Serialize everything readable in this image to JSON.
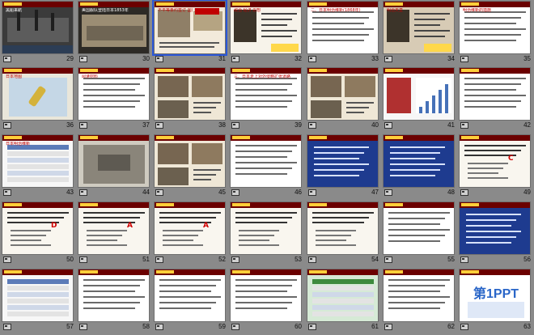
{
  "view": "slide-sorter",
  "selected_slide": 31,
  "slides": [
    {
      "number": "29",
      "title": "黑船来航",
      "style": "dark-ship"
    },
    {
      "number": "30",
      "title": "美国舰队登陆日本1853年",
      "style": "dark-photo"
    },
    {
      "number": "31",
      "title": "不平等条约签订 国门洞开",
      "style": "beige-photo"
    },
    {
      "number": "32",
      "title": "政治 经济 思想",
      "style": "portrait"
    },
    {
      "number": "33",
      "title": "二、日本明治维新(1868年)",
      "style": "white-text"
    },
    {
      "number": "34",
      "title": "明治天皇",
      "style": "portrait-dark"
    },
    {
      "number": "35",
      "title": "明治维新的措施",
      "style": "white-text"
    },
    {
      "number": "36",
      "title": "日本地图",
      "style": "map"
    },
    {
      "number": "37",
      "title": "阅读材料",
      "style": "white-text"
    },
    {
      "number": "38",
      "title": "",
      "style": "photos"
    },
    {
      "number": "39",
      "title": "三、日本走上对外侵略扩张道路",
      "style": "white-text"
    },
    {
      "number": "40",
      "title": "",
      "style": "photos"
    },
    {
      "number": "41",
      "title": "",
      "style": "chart"
    },
    {
      "number": "42",
      "title": "",
      "style": "white-text"
    },
    {
      "number": "43",
      "title": "日本明治维新",
      "style": "table"
    },
    {
      "number": "44",
      "title": "",
      "style": "sketch"
    },
    {
      "number": "45",
      "title": "",
      "style": "photos"
    },
    {
      "number": "46",
      "title": "",
      "style": "white-text"
    },
    {
      "number": "47",
      "title": "",
      "style": "blue-dark"
    },
    {
      "number": "48",
      "title": "",
      "style": "blue-dark"
    },
    {
      "number": "49",
      "title": "C",
      "style": "quiz"
    },
    {
      "number": "50",
      "title": "D",
      "style": "quiz"
    },
    {
      "number": "51",
      "title": "A",
      "style": "quiz"
    },
    {
      "number": "52",
      "title": "A",
      "style": "quiz"
    },
    {
      "number": "53",
      "title": "",
      "style": "quiz"
    },
    {
      "number": "54",
      "title": "",
      "style": "quiz"
    },
    {
      "number": "55",
      "title": "",
      "style": "white-text"
    },
    {
      "number": "56",
      "title": "",
      "style": "blue-dark"
    },
    {
      "number": "57",
      "title": "",
      "style": "table"
    },
    {
      "number": "58",
      "title": "",
      "style": "white-text"
    },
    {
      "number": "59",
      "title": "",
      "style": "white-text"
    },
    {
      "number": "60",
      "title": "",
      "style": "white-text"
    },
    {
      "number": "61",
      "title": "",
      "style": "green-table"
    },
    {
      "number": "62",
      "title": "",
      "style": "white-text"
    },
    {
      "number": "63",
      "title": "第1PPT",
      "style": "logo"
    }
  ],
  "colors": {
    "background": "#8a8a8a",
    "selection": "#2b57d8",
    "header": "#6b0000"
  }
}
